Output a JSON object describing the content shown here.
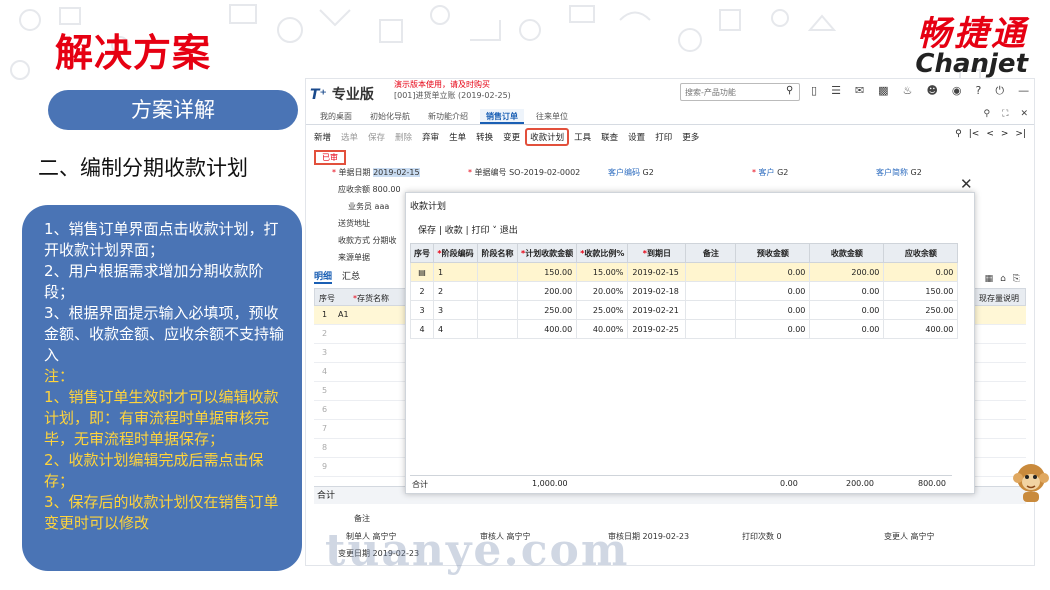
{
  "slide": {
    "title": "解决方案",
    "brand_cn": "畅捷通",
    "brand_en": "Chanjet",
    "pill": "方案详解",
    "subtitle": "二、编制分期收款计划",
    "watermark": "tuanye.com",
    "notes_white": [
      "1、销售订单界面点击收款计划，打开收款计划界面；",
      "2、用户根据需求增加分期收款阶段；",
      "3、根据界面提示输入必填项，预收金额、收款金额、应收余额不支持输入"
    ],
    "notes_yellow": [
      "注：",
      "1、销售订单生效时才可以编辑收款计划，即：有审流程时单据审核完毕，无审流程时单据保存；",
      "2、收款计划编辑完成后需点击保存；",
      "3、保存后的收款计划仅在销售订单变更时可以修改"
    ],
    "accent": "#e60012",
    "card_color": "#4a74b5"
  },
  "app": {
    "logo_t": "T⁺",
    "logo_text": "专业版",
    "demo_warning": "演示版本使用，请及时购买",
    "account": "[001]进货单立账   (2019-02-25)",
    "search_placeholder": "搜索-产品功能",
    "tabs": [
      "我的桌面",
      "初始化导航",
      "新功能介绍",
      "销售订单",
      "往来单位"
    ],
    "active_tab": "销售订单",
    "toolbar": [
      "新增",
      "选单",
      "保存",
      "删除",
      "弃审",
      "生单",
      "转换",
      "变更",
      "收款计划",
      "工具",
      "联查",
      "设置",
      "打印",
      "更多"
    ],
    "status": "已审",
    "header": {
      "date_label": "单据日期",
      "date_value": "2019-02-15",
      "code_label": "单据编号",
      "code_value": "SO-2019-02-0002",
      "custcode_label": "客户编码",
      "custcode_value": "G2",
      "cust_label": "客户",
      "cust_value": "G2",
      "custabbr_label": "客户简称",
      "custabbr_value": "G2",
      "balance_label": "应收余额",
      "balance_value": "800.00",
      "sales_label": "业务员",
      "sales_value": "aaa",
      "addr_label": "送货地址",
      "payway_label": "收款方式",
      "payway_value": "分期收",
      "source_label": "来源单据"
    },
    "detail_tabs": [
      "明细",
      "汇总"
    ],
    "grid_headers": [
      "序号",
      "存货名称"
    ],
    "grid_first_row": [
      "1",
      "A1"
    ],
    "grid_row_numbers": [
      "2",
      "3",
      "4",
      "5",
      "6",
      "7",
      "8",
      "9"
    ],
    "grid_right_header": "现存量说明",
    "sum_label": "合计",
    "footer": {
      "remark_label": "备注",
      "maker_label": "制单人",
      "maker_value": "高宁宁",
      "auditor_label": "审核人",
      "auditor_value": "高宁宁",
      "auditdate_label": "审核日期",
      "auditdate_value": "2019-02-23",
      "print_label": "打印次数",
      "print_value": "0",
      "changer_label": "变更人",
      "changer_value": "高宁宁",
      "changedate_label": "变更日期",
      "changedate_value": "2019-02-23"
    }
  },
  "dialog": {
    "title": "收款计划",
    "tools": "保存 | 收款 | 打印 ˅   退出",
    "columns": [
      "序号",
      "阶段编码",
      "阶段名称",
      "计划收款金额",
      "收款比例%",
      "到期日",
      "备注",
      "预收金额",
      "收款金额",
      "应收余额"
    ],
    "required_columns": [
      false,
      true,
      false,
      true,
      true,
      true,
      false,
      false,
      false,
      false
    ],
    "rows": [
      {
        "no": "1",
        "code": "1",
        "name": "",
        "plan": "150.00",
        "ratio": "15.00%",
        "due": "2019-02-15",
        "remark": "",
        "pre": "0.00",
        "recv": "200.00",
        "bal": "0.00"
      },
      {
        "no": "2",
        "code": "2",
        "name": "",
        "plan": "200.00",
        "ratio": "20.00%",
        "due": "2019-02-18",
        "remark": "",
        "pre": "0.00",
        "recv": "0.00",
        "bal": "150.00"
      },
      {
        "no": "3",
        "code": "3",
        "name": "",
        "plan": "250.00",
        "ratio": "25.00%",
        "due": "2019-02-21",
        "remark": "",
        "pre": "0.00",
        "recv": "0.00",
        "bal": "250.00"
      },
      {
        "no": "4",
        "code": "4",
        "name": "",
        "plan": "400.00",
        "ratio": "40.00%",
        "due": "2019-02-25",
        "remark": "",
        "pre": "0.00",
        "recv": "0.00",
        "bal": "400.00"
      }
    ],
    "total_label": "合计",
    "total_plan": "1,000.00",
    "total_pre": "0.00",
    "total_recv": "200.00",
    "total_bal": "800.00"
  }
}
